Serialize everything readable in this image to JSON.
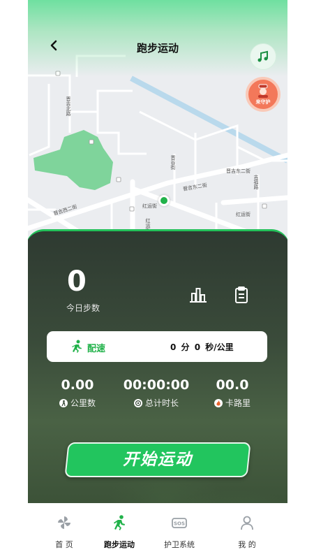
{
  "header": {
    "title": "跑步运动",
    "guard_label": "来守护"
  },
  "map": {
    "streets": [
      "晋吉北路",
      "晋谷街",
      "晋吉东二街",
      "吉福路",
      "晋吉西二街",
      "红运街",
      "晋吉东二街",
      "红运街",
      "红运街"
    ]
  },
  "stats": {
    "today_steps": "0",
    "today_steps_label": "今日步数",
    "pace_label": "配速",
    "pace_value": "0 分 0  秒/公里",
    "distance": "0.00",
    "distance_label": "公里数",
    "duration": "00:00:00",
    "duration_label": "总计时长",
    "calories": "00.0",
    "calories_label": "卡路里"
  },
  "start_button": "开始运动",
  "tabs": [
    {
      "label": "首 页",
      "icon": "pinwheel-icon"
    },
    {
      "label": "跑步运动",
      "icon": "runner-icon"
    },
    {
      "label": "护卫系统",
      "icon": "sos-icon"
    },
    {
      "label": "我 的",
      "icon": "person-icon"
    }
  ],
  "colors": {
    "accent": "#22c55e",
    "guard": "#f3785a"
  }
}
